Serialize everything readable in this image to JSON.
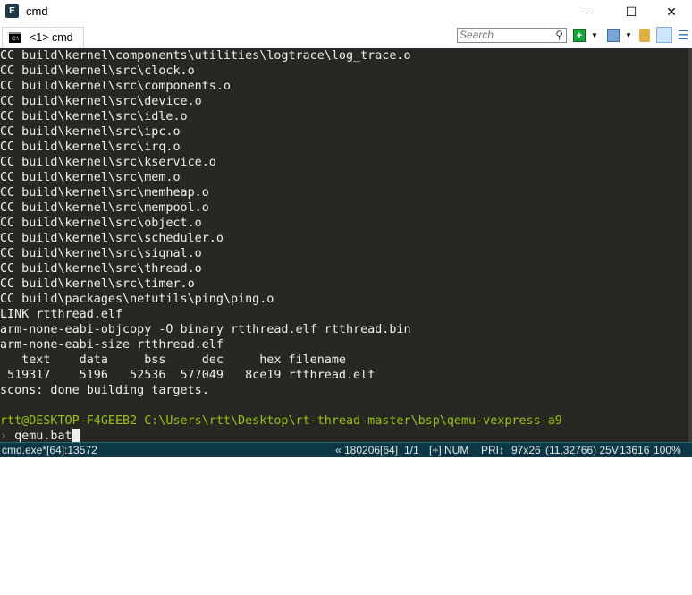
{
  "window": {
    "title": "cmd",
    "minimize": "–",
    "maximize": "☐",
    "close": "✕"
  },
  "tabbar": {
    "tab_label": "<1> cmd",
    "search_placeholder": "Search"
  },
  "terminal": {
    "lines": [
      "CC build\\kernel\\components\\utilities\\logtrace\\log_trace.o",
      "CC build\\kernel\\src\\clock.o",
      "CC build\\kernel\\src\\components.o",
      "CC build\\kernel\\src\\device.o",
      "CC build\\kernel\\src\\idle.o",
      "CC build\\kernel\\src\\ipc.o",
      "CC build\\kernel\\src\\irq.o",
      "CC build\\kernel\\src\\kservice.o",
      "CC build\\kernel\\src\\mem.o",
      "CC build\\kernel\\src\\memheap.o",
      "CC build\\kernel\\src\\mempool.o",
      "CC build\\kernel\\src\\object.o",
      "CC build\\kernel\\src\\scheduler.o",
      "CC build\\kernel\\src\\signal.o",
      "CC build\\kernel\\src\\thread.o",
      "CC build\\kernel\\src\\timer.o",
      "CC build\\packages\\netutils\\ping\\ping.o",
      "LINK rtthread.elf",
      "arm-none-eabi-objcopy -O binary rtthread.elf rtthread.bin",
      "arm-none-eabi-size rtthread.elf",
      "   text    data     bss     dec     hex filename",
      " 519317    5196   52536  577049   8ce19 rtthread.elf",
      "scons: done building targets.",
      ""
    ],
    "prompt": "rtt@DESKTOP-F4GEEB2 C:\\Users\\rtt\\Desktop\\rt-thread-master\\bsp\\qemu-vexpress-a9",
    "prompt_symbol": "›",
    "command": " qemu.bat"
  },
  "status": {
    "process": "cmd.exe*[64]:13572",
    "pid": "« 180206[64]",
    "console": "1/1",
    "keys": "[+] NUM",
    "priority": "PRI↕",
    "size": "97x26",
    "cursor": "(11,32766) 25V",
    "server_pid": "13616",
    "zoom": "100%"
  },
  "colors": {
    "background": "#272822",
    "prompt": "#9ac01b",
    "statusbar": "#0b3746"
  }
}
